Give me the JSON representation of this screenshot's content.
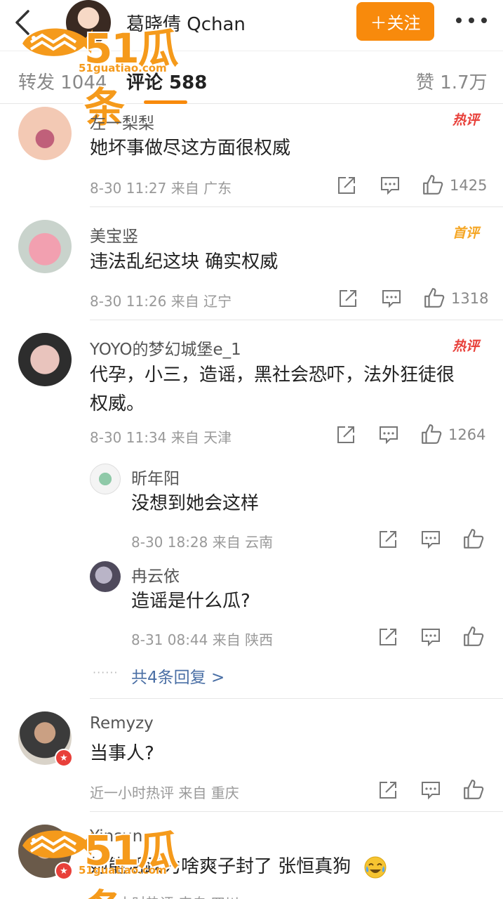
{
  "header": {
    "username": "葛晓倩 Qchan",
    "follow_label": "＋关注"
  },
  "tabs": {
    "repost": "转发 1044",
    "comments": "评论 588",
    "likes": "赞 1.7万"
  },
  "watermark": {
    "brand": "51瓜条",
    "url": "51guatiao.com"
  },
  "comments": [
    {
      "user": "左一梨梨",
      "badge": "热评",
      "text": "她坏事做尽这方面很权威",
      "meta": "8-30 11:27  来自 广东",
      "likes": "1425"
    },
    {
      "user": "美宝竖",
      "badge": "首评",
      "text": "违法乱纪这块 确实权威",
      "meta": "8-30 11:26  来自 辽宁",
      "likes": "1318"
    },
    {
      "user": "YOYO的梦幻城堡e_1",
      "badge": "热评",
      "text_line1": "代孕，小三，造谣，黑社会恐吓，法外狂徒很",
      "text_line2": "权威。",
      "meta": "8-30 11:34  来自 天津",
      "likes": "1264"
    },
    {
      "user": "Remyzy",
      "text": "当事人?",
      "meta": "近一小时热评  来自 重庆"
    },
    {
      "user": "Yinsun",
      "text": "她能活跃为啥爽子封了 张恒真狗",
      "meta": "近一小时热评  来自 四川"
    }
  ],
  "replies": [
    {
      "user": "昕年阳",
      "text": "没想到她会这样",
      "meta": "8-30 18:28  来自 云南"
    },
    {
      "user": "冉云依",
      "text": "造谣是什么瓜?",
      "meta": "8-31 08:44  来自 陕西"
    }
  ],
  "more_replies": "共4条回复 >",
  "colors": {
    "accent": "#f88a0c",
    "hot_badge": "#e8403a",
    "first_badge": "#f5a623",
    "link": "#4a6fa5"
  }
}
